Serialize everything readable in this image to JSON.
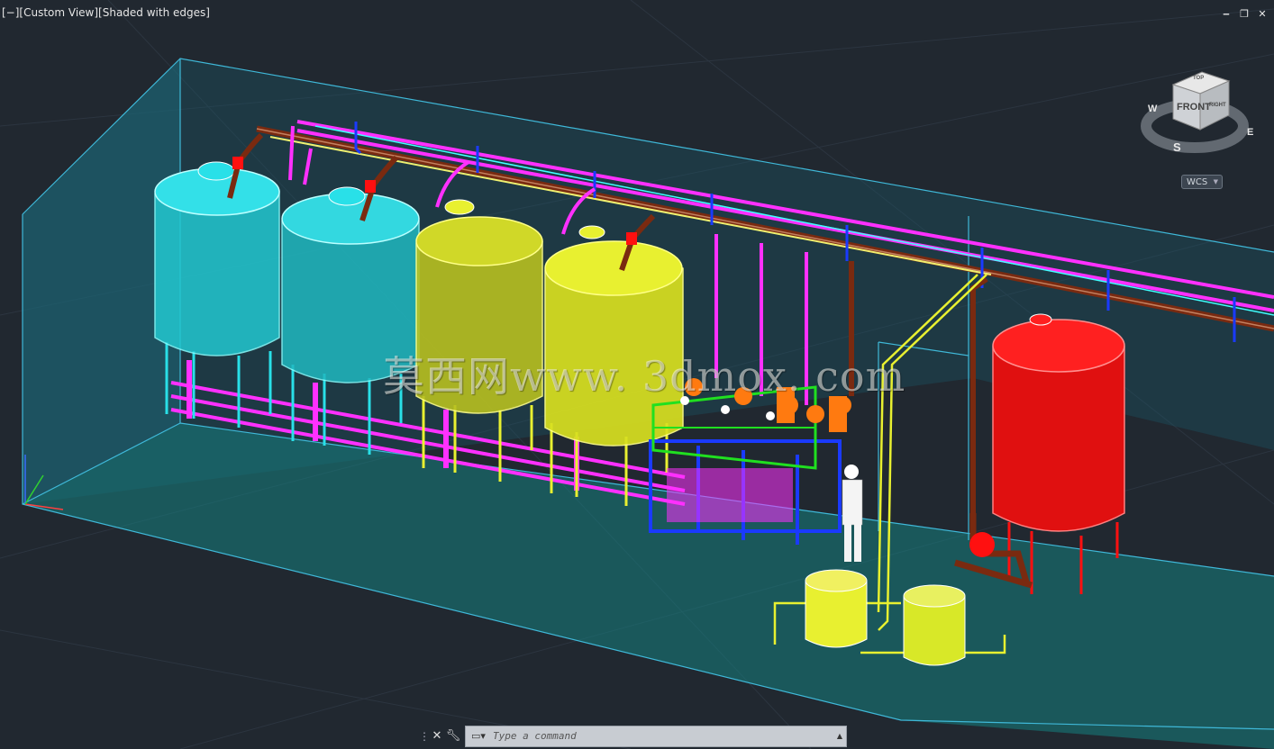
{
  "viewport": {
    "label": "[−][Custom View][Shaded with edges]",
    "minimize_icon": "minimize-icon",
    "restore_icon": "restore-icon",
    "close_icon": "close-icon"
  },
  "viewcube": {
    "face_front": "FRONT",
    "face_top": "TOP",
    "face_right": "RIGHT",
    "compass_w": "W",
    "compass_s": "S",
    "compass_e": "E"
  },
  "wcs": {
    "label": "WCS"
  },
  "watermark": {
    "text": "莫西网www. 3dmox. com"
  },
  "command_line": {
    "placeholder": "Type a command",
    "close_icon": "close-icon",
    "customize_icon": "wrench-icon"
  },
  "colors": {
    "background": "#212830",
    "tank_cyan": "#29e0e8",
    "tank_yellow": "#e8f030",
    "tank_red": "#ff1010",
    "pipe_magenta": "#ff30ff",
    "pipe_brown": "#7a2a10",
    "frame_blue": "#1a3aff",
    "frame_green": "#20e020",
    "floor_teal": "#1e8a88"
  }
}
